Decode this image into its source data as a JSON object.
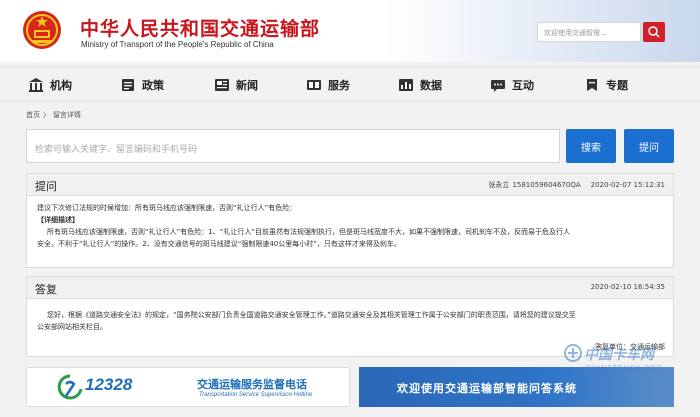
{
  "header": {
    "title": "中华人民共和国交通运输部",
    "subtitle": "Ministry of Transport of the People's Republic of China",
    "search_placeholder": "欢迎使用交通智搜..."
  },
  "nav": {
    "items": [
      {
        "label": "机构",
        "icon": "building-icon"
      },
      {
        "label": "政策",
        "icon": "document-icon"
      },
      {
        "label": "新闻",
        "icon": "newspaper-icon"
      },
      {
        "label": "服务",
        "icon": "service-icon"
      },
      {
        "label": "数据",
        "icon": "chart-icon"
      },
      {
        "label": "互动",
        "icon": "chat-icon"
      },
      {
        "label": "专题",
        "icon": "topic-icon"
      }
    ]
  },
  "breadcrumb": {
    "home": "首页",
    "sep": "〉",
    "current": "留言详情"
  },
  "search": {
    "placeholder": "检索可输入关键字、留言编码和手机号码",
    "search_label": "搜索",
    "ask_label": "提问"
  },
  "question": {
    "heading": "提问",
    "author": "张永立",
    "code": "1581059604670QA",
    "time": "2020-02-07 15:12:31",
    "summary": "建议下次修订法规的时候增加：所有斑马线应该强制限速，否则“礼让行人”有危险：",
    "detail_label": "【详细描述】",
    "detail_line1": "所有斑马线应该强制限速，否则“礼让行人”有危险：1、“礼让行人”目前虽然有法规强制执行，但是斑马线宽度不大，如果不强制限速，司机刹车不及，反而易于危及行人",
    "detail_line2": "安全，不利于“礼让行人”的操作。2、没有交通信号的斑马线建议“强制限速40公里每小时”，只有这样才来得及刹车。"
  },
  "answer": {
    "heading": "答复",
    "time": "2020-02-10 16:54:35",
    "line1": "您好，根据《道路交通安全法》的规定，“国务院公安部门负责全国道路交通安全管理工作。”道路交通安全及其相关管理工作属于公安部门的职责范围，请将您的建议提交至",
    "line2": "公安部网站相关栏目。",
    "sign": "答复单位：交通运输部"
  },
  "banners": {
    "hotline_number": "12328",
    "hotline_cn": "交通运输服务监督电话",
    "hotline_en": "Transportation Service Supervision Hotline",
    "welcome": "欢迎使用交通运输部智能问答系统"
  },
  "watermark": {
    "cn": "中国卡车网",
    "en": "CHINATRUCK.ORG"
  },
  "colors": {
    "brand_red": "#c8161d",
    "button_blue": "#1a6fd1"
  }
}
